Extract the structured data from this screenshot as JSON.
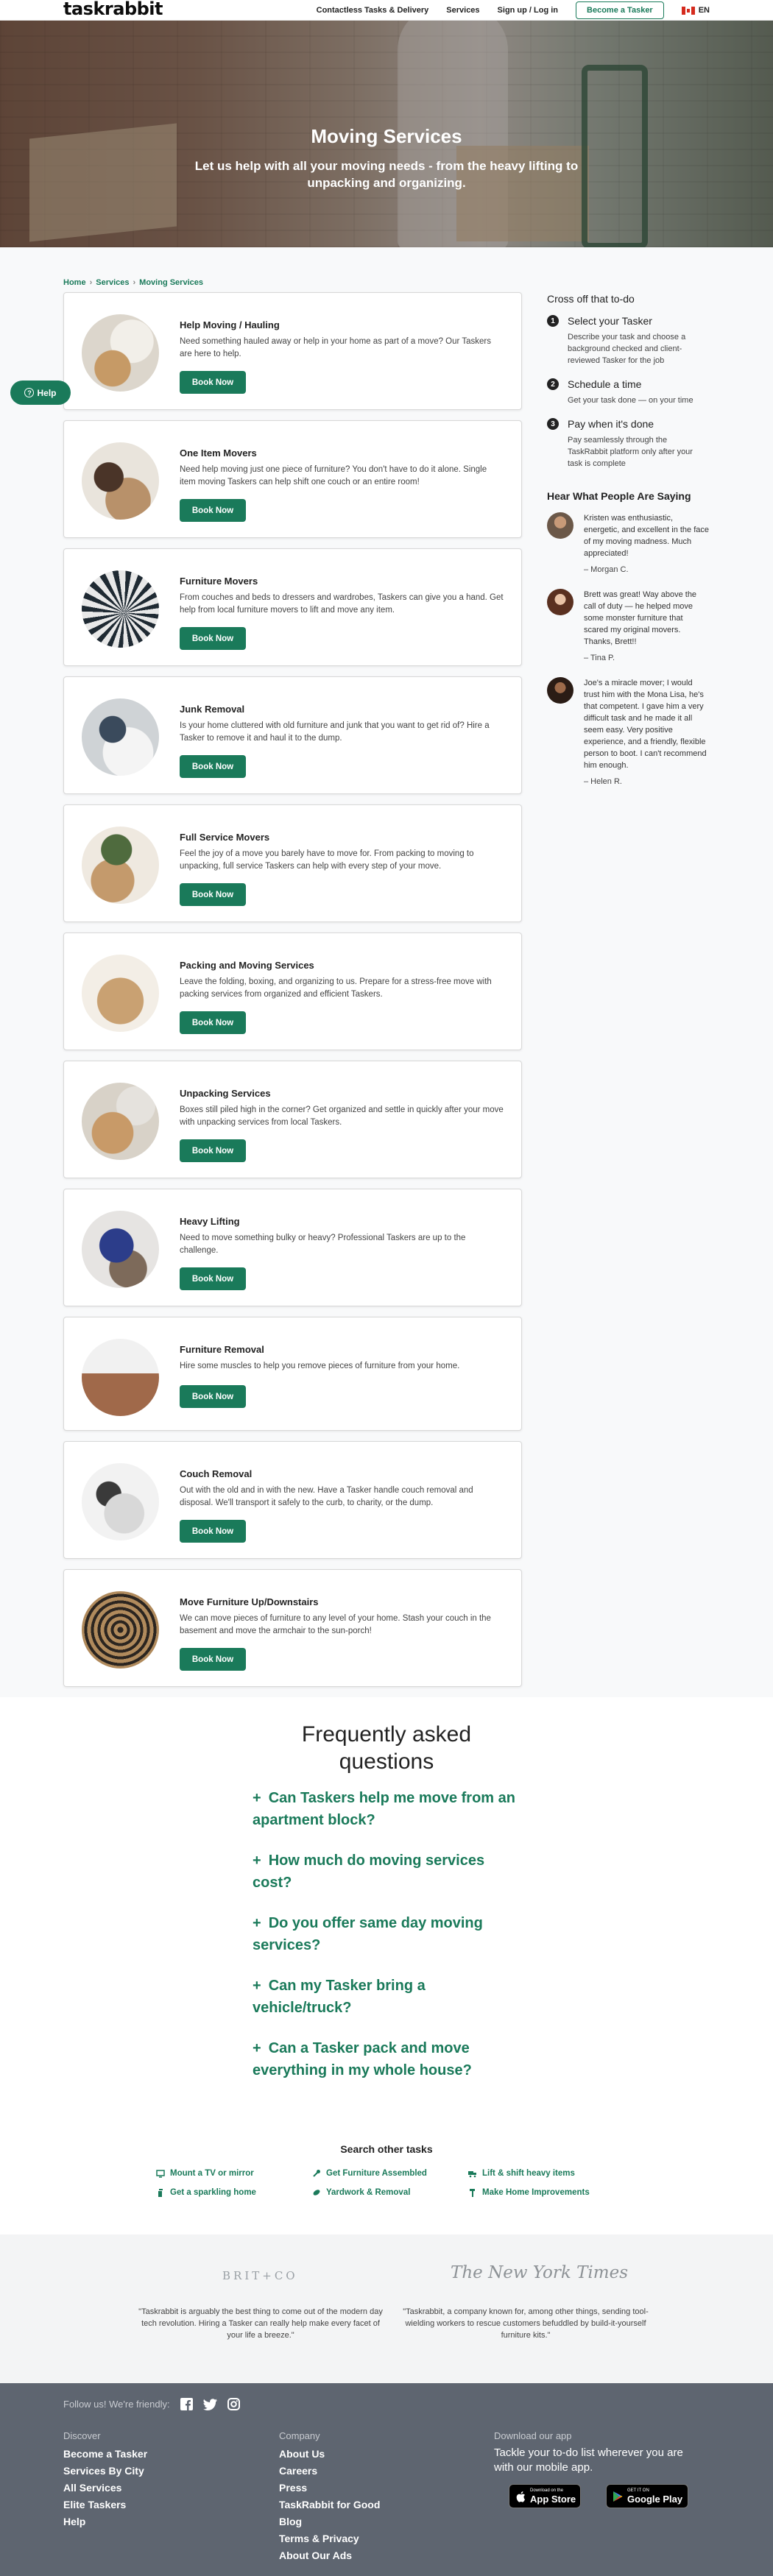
{
  "header": {
    "logo": "taskrabbit",
    "nav": [
      "Contactless Tasks & Delivery",
      "Services",
      "Sign up / Log in"
    ],
    "cta": "Become a Tasker",
    "locale": "EN"
  },
  "hero": {
    "title": "Moving Services",
    "subtitle": "Let us help with all your moving needs - from the heavy lifting to unpacking and organizing."
  },
  "breadcrumb": [
    "Home",
    "Services",
    "Moving Services"
  ],
  "help_label": "Help",
  "book_label": "Book Now",
  "services": [
    {
      "title": "Help Moving / Hauling",
      "desc": "Need something hauled away or help in your home as part of a move? Our Taskers are here to help."
    },
    {
      "title": "One Item Movers",
      "desc": "Need help moving just one piece of furniture? You don't have to do it alone. Single item moving Taskers can help shift one couch or an entire room!"
    },
    {
      "title": "Furniture Movers",
      "desc": "From couches and beds to dressers and wardrobes, Taskers can give you a hand. Get help from local furniture movers to lift and move any item."
    },
    {
      "title": "Junk Removal",
      "desc": "Is your home cluttered with old furniture and junk that you want to get rid of? Hire a Tasker to remove it and haul it to the dump."
    },
    {
      "title": "Full Service Movers",
      "desc": "Feel the joy of a move you barely have to move for. From packing to moving to unpacking, full service Taskers can help with every step of your move."
    },
    {
      "title": "Packing and Moving Services",
      "desc": "Leave the folding, boxing, and organizing to us. Prepare for a stress-free move with packing services from organized and efficient Taskers."
    },
    {
      "title": "Unpacking Services",
      "desc": "Boxes still piled high in the corner? Get organized and settle in quickly after your move with unpacking services from local Taskers."
    },
    {
      "title": "Heavy Lifting",
      "desc": "Need to move something bulky or heavy? Professional Taskers are up to the challenge."
    },
    {
      "title": "Furniture Removal",
      "desc": "Hire some muscles to help you remove pieces of furniture from your home."
    },
    {
      "title": "Couch Removal",
      "desc": "Out with the old and in with the new. Have a Tasker handle couch removal and disposal. We'll transport it safely to the curb, to charity, or the dump."
    },
    {
      "title": "Move Furniture Up/Downstairs",
      "desc": "We can move pieces of furniture to any level of your home. Stash your couch in the basement and move the armchair to the sun-porch!"
    }
  ],
  "sidebar": {
    "title": "Cross off that to-do",
    "steps": [
      {
        "num": "1",
        "title": "Select your Tasker",
        "desc": "Describe your task and choose a background checked and client-reviewed Tasker for the job"
      },
      {
        "num": "2",
        "title": "Schedule a time",
        "desc": "Get your task done — on your time"
      },
      {
        "num": "3",
        "title": "Pay when it's done",
        "desc": "Pay seamlessly through the TaskRabbit platform only after your task is complete"
      }
    ],
    "reviews_title": "Hear What People Are Saying",
    "reviews": [
      {
        "text": "Kristen was enthusiastic, energetic, and excellent in the face of my moving madness. Much appreciated!",
        "author": "– Morgan C."
      },
      {
        "text": "Brett was great! Way above the call of duty — he helped move some monster furniture that scared my original movers. Thanks, Brett!!",
        "author": "– Tina P."
      },
      {
        "text": "Joe's a miracle mover; I would trust him with the Mona Lisa, he's that competent. I gave him a very difficult task and he made it all seem easy. Very positive experience, and a friendly, flexible person to boot. I can't recommend him enough.",
        "author": "– Helen R."
      }
    ]
  },
  "faq": {
    "title": "Frequently asked questions",
    "items": [
      "Can Taskers help me move from an apartment block?",
      "How much do moving services cost?",
      "Do you offer same day moving services?",
      "Can my Tasker bring a vehicle/truck?",
      "Can a Tasker pack and move everything in my whole house?"
    ]
  },
  "search_other": {
    "title": "Search other tasks",
    "items": [
      {
        "label": "Mount a TV or mirror",
        "icon": "tv-icon"
      },
      {
        "label": "Get Furniture Assembled",
        "icon": "wrench-icon"
      },
      {
        "label": "Lift & shift heavy items",
        "icon": "truck-icon"
      },
      {
        "label": "Get a sparkling home",
        "icon": "spray-icon"
      },
      {
        "label": "Yardwork & Removal",
        "icon": "leaf-icon"
      },
      {
        "label": "Make Home Improvements",
        "icon": "hammer-icon"
      }
    ]
  },
  "press": {
    "brit_logo": "BRIT+CO",
    "nyt_logo": "The New York Times",
    "quote1": "\"Taskrabbit is arguably the best thing to come out of the modern day tech revolution. Hiring a Tasker can really help make every facet of your life a breeze.\"",
    "quote2": "\"Taskrabbit, a company known for, among other things, sending tool-wielding workers to rescue customers befuddled by build-it-yourself furniture kits.\""
  },
  "footer": {
    "follow": "Follow us! We're friendly:",
    "discover_title": "Discover",
    "discover": [
      "Become a Tasker",
      "Services By City",
      "All Services",
      "Elite Taskers",
      "Help"
    ],
    "company_title": "Company",
    "company": [
      "About Us",
      "Careers",
      "Press",
      "TaskRabbit for Good",
      "Blog",
      "Terms & Privacy",
      "About Our Ads"
    ],
    "app_title": "Download our app",
    "app_desc": "Tackle your to-do list wherever you are with our mobile app.",
    "appstore_small": "Download on the",
    "appstore": "App Store",
    "googleplay_small": "GET IT ON",
    "googleplay": "Google Play"
  },
  "colors": {
    "brand_green": "#1a7a5a",
    "footer_bg": "#5e6570"
  }
}
